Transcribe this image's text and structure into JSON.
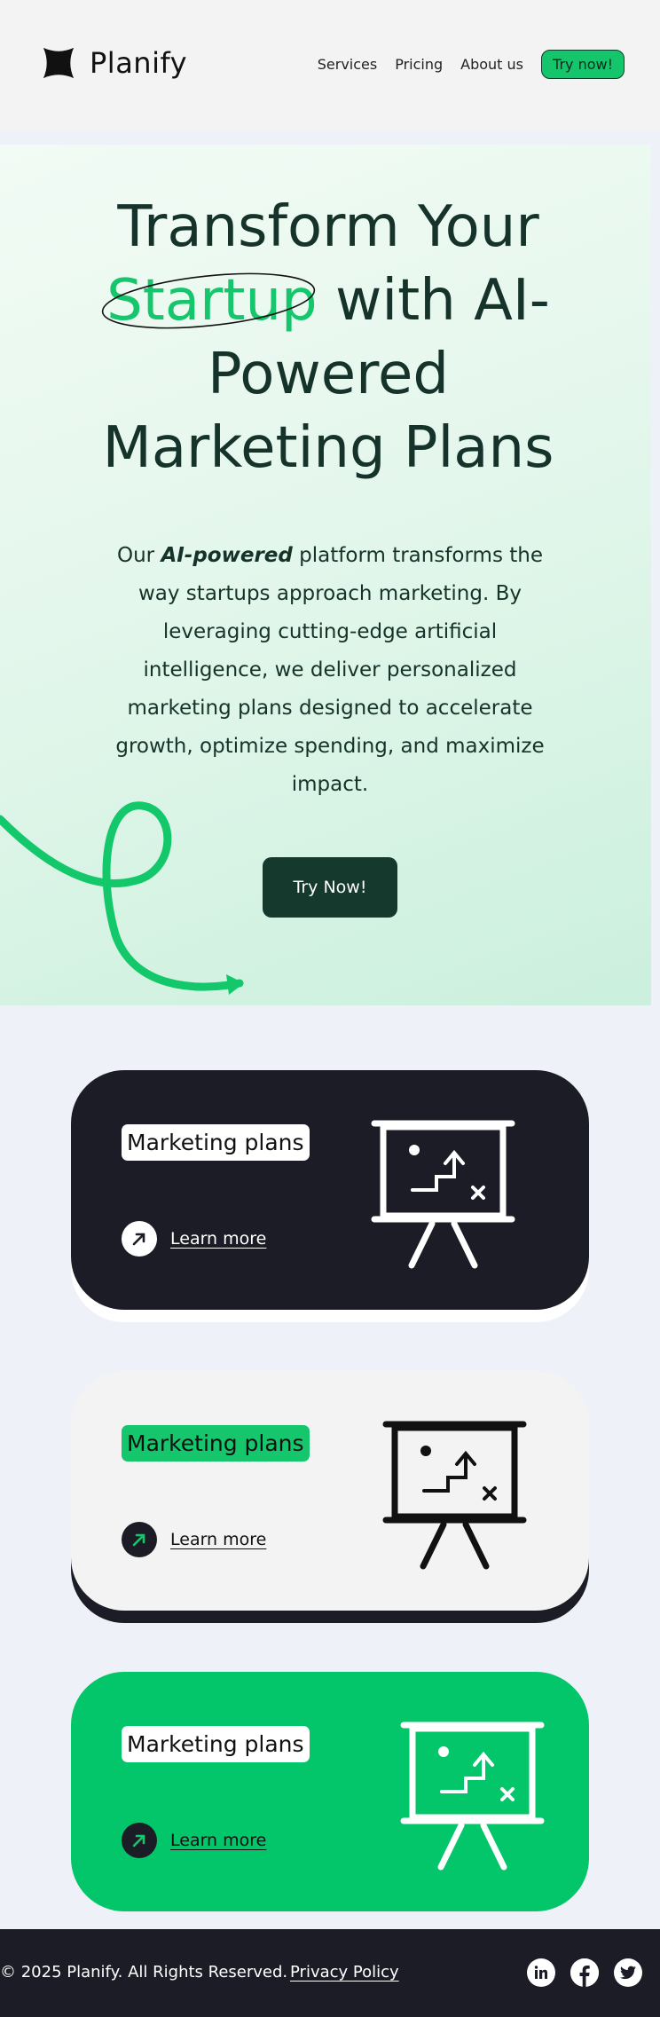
{
  "brand": {
    "name": "Planify",
    "logo_icon": "four-point-star-icon"
  },
  "nav": {
    "items": [
      {
        "label": "Services"
      },
      {
        "label": "Pricing"
      },
      {
        "label": "About us"
      }
    ],
    "cta_label": "Try now!"
  },
  "hero": {
    "title_line1": "Transform Your",
    "title_highlight": "Startup",
    "title_rest": " with AI-",
    "title_line3": "Powered",
    "title_line4": "Marketing Plans",
    "desc_prefix": "Our ",
    "desc_emphasis": "AI-powered",
    "desc_suffix": " platform transforms the way startups approach marketing. By leveraging cutting-edge artificial intelligence, we deliver personalized marketing plans designed to accelerate growth, optimize spending, and maximize impact.",
    "cta_label": "Try Now!"
  },
  "cards": [
    {
      "title": "Marketing plans",
      "link_label": "Learn more",
      "icon": "presentation-board-icon"
    },
    {
      "title": "Marketing plans",
      "link_label": "Learn more",
      "icon": "presentation-board-icon"
    },
    {
      "title": "Marketing plans",
      "link_label": "Learn more",
      "icon": "presentation-board-icon"
    }
  ],
  "colors": {
    "accent": "#16c66d",
    "dark": "#1c1c26",
    "hero_text": "#15332a"
  },
  "footer": {
    "copyright": "© 2025 Planify. All Rights Reserved.",
    "privacy_label": "Privacy Policy",
    "socials": [
      "linkedin-icon",
      "facebook-icon",
      "twitter-icon"
    ]
  }
}
